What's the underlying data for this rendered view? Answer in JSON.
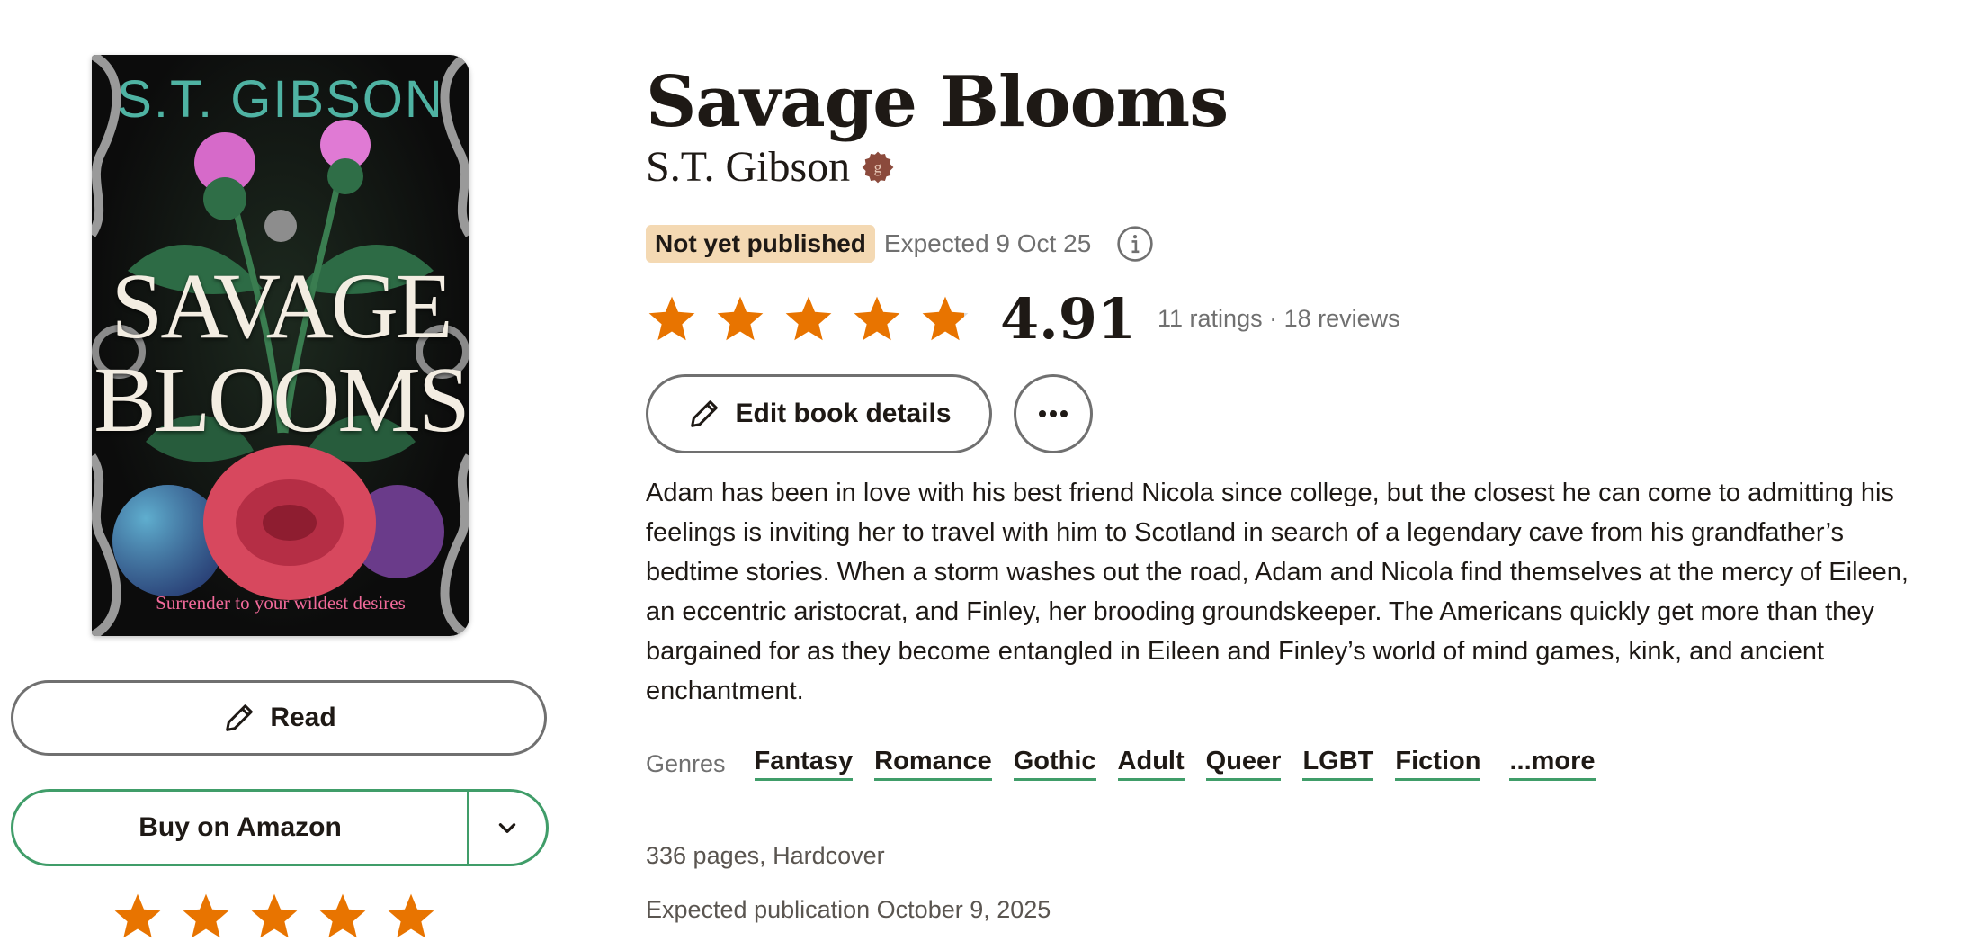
{
  "cover": {
    "author_text": "S.T. GIBSON",
    "title_line1": "SAVAGE",
    "title_line2": "BLOOMS",
    "tagline": "Surrender to your wildest desires"
  },
  "left_actions": {
    "read_label": "Read",
    "buy_label": "Buy on Amazon",
    "user_rating_stars": 5
  },
  "book": {
    "title": "Savage Blooms",
    "author": "S.T. Gibson",
    "status_badge": "Not yet published",
    "expected": "Expected 9 Oct 25",
    "rating": "4.91",
    "rating_fraction": 0.91,
    "rating_meta": "11 ratings · 18 reviews",
    "description": "Adam has been in love with his best friend Nicola since college, but the closest he can come to admitting his feelings is inviting her to travel with him to Scotland in search of a legendary cave from his grandfather’s bedtime stories. When a storm washes out the road, Adam and Nicola find themselves at the mercy of Eileen, an eccentric aristocrat, and Finley, her brooding groundskeeper. The Americans quickly get more than they bargained for as they become entangled in Eileen and Finley’s world of mind games, kink, and ancient enchantment.",
    "pages": "336 pages, Hardcover",
    "publication": "Expected publication October 9, 2025"
  },
  "actions": {
    "edit_label": "Edit book details"
  },
  "genres": {
    "label": "Genres",
    "items": [
      "Fantasy",
      "Romance",
      "Gothic",
      "Adult",
      "Queer",
      "LGBT",
      "Fiction"
    ],
    "more_label": "...more"
  },
  "colors": {
    "star": "#e87400",
    "green": "#409d69",
    "badge_bg": "#f4d9b3",
    "author_badge": "#8b4a3c"
  }
}
